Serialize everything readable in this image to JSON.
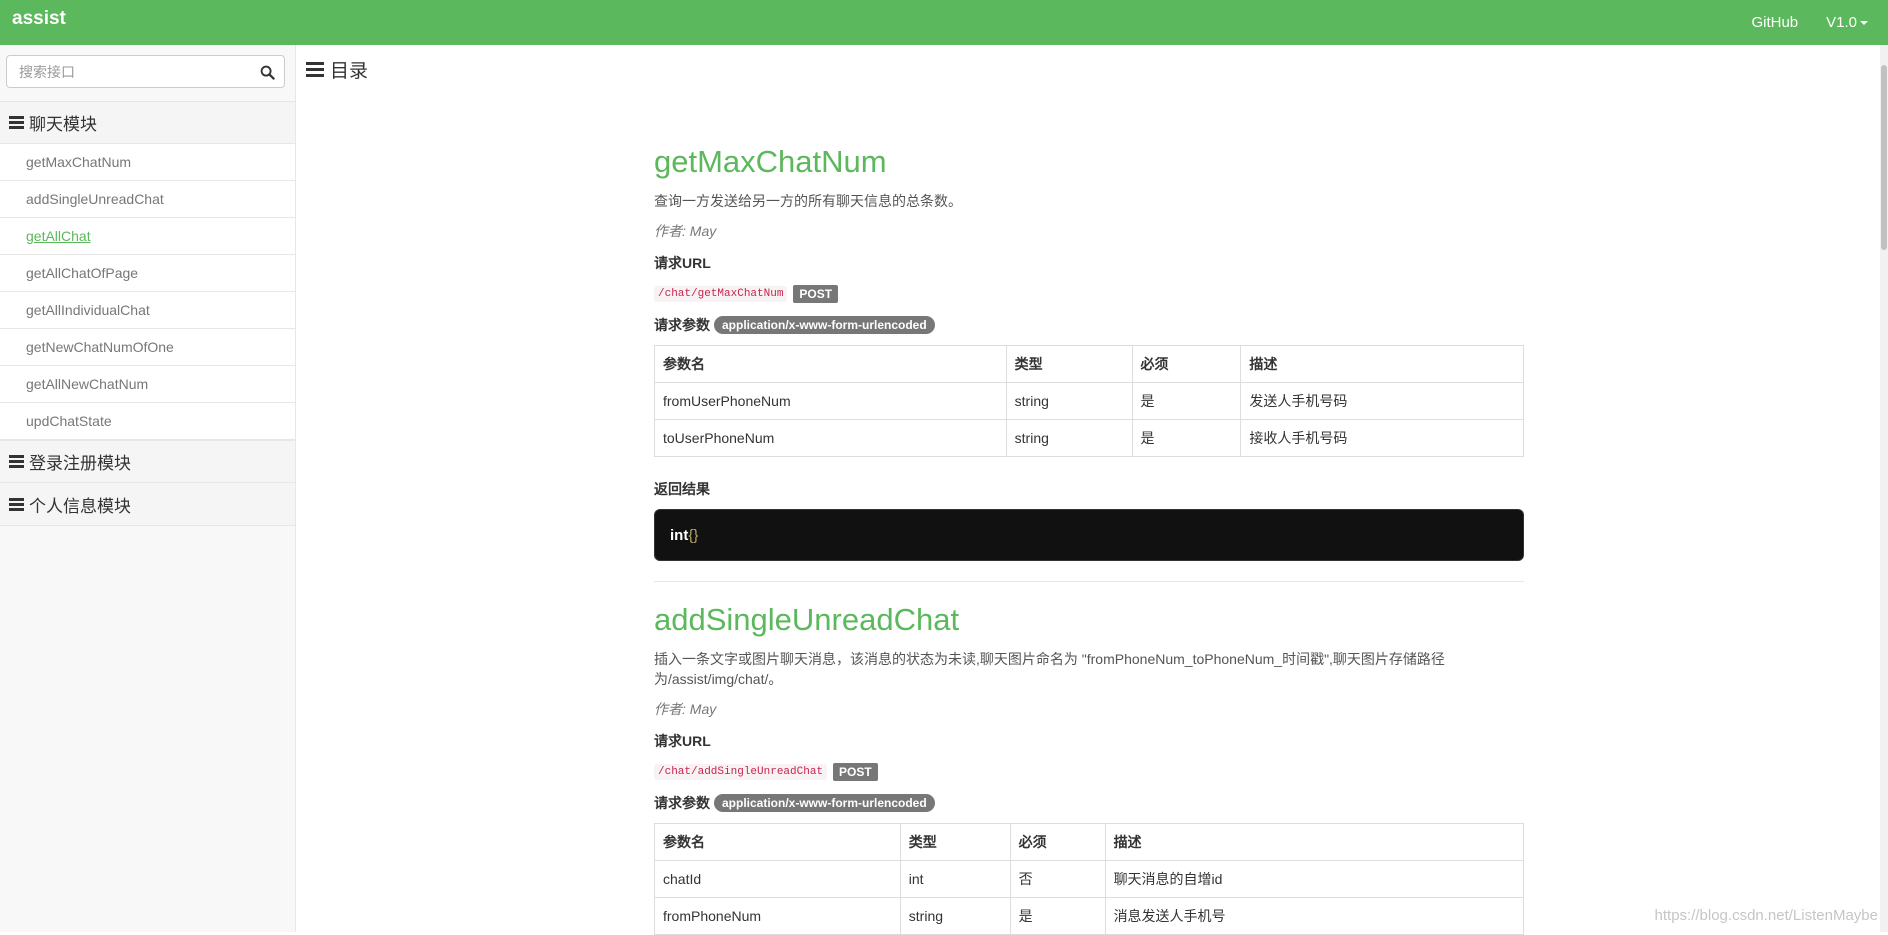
{
  "topbar": {
    "brand": "assist",
    "github": "GitHub",
    "version": "V1.0"
  },
  "search": {
    "placeholder": "搜索接口"
  },
  "sidebar": {
    "groups": [
      {
        "label": "聊天模块",
        "items": [
          "getMaxChatNum",
          "addSingleUnreadChat",
          "getAllChat",
          "getAllChatOfPage",
          "getAllIndividualChat",
          "getNewChatNumOfOne",
          "getAllNewChatNum",
          "updChatState"
        ]
      },
      {
        "label": "登录注册模块"
      },
      {
        "label": "个人信息模块"
      }
    ],
    "active_item": "getAllChat"
  },
  "toc": {
    "label": "目录"
  },
  "apis": [
    {
      "title": "getMaxChatNum",
      "desc": "查询一方发送给另一方的所有聊天信息的总条数。",
      "author": "作者: May",
      "url_label": "请求URL",
      "url": "/chat/getMaxChatNum",
      "method": "POST",
      "params_label": "请求参数",
      "content_type": "application/x-www-form-urlencoded",
      "headers": [
        "参数名",
        "类型",
        "必须",
        "描述"
      ],
      "rows": [
        [
          "fromUserPhoneNum",
          "string",
          "是",
          "发送人手机号码"
        ],
        [
          "toUserPhoneNum",
          "string",
          "是",
          "接收人手机号码"
        ]
      ],
      "result_label": "返回结果",
      "result_type": "int",
      "result_body": "{}"
    },
    {
      "title": "addSingleUnreadChat",
      "desc_line1": "插入一条文字或图片聊天消息，该消息的状态为未读,聊天图片命名为 \"fromPhoneNum_toPhoneNum_时间戳\",聊天图片存储路径",
      "desc_line2": "为/assist/img/chat/。",
      "author": "作者: May",
      "url_label": "请求URL",
      "url": "/chat/addSingleUnreadChat",
      "method": "POST",
      "params_label": "请求参数",
      "content_type": "application/x-www-form-urlencoded",
      "headers": [
        "参数名",
        "类型",
        "必须",
        "描述"
      ],
      "rows": [
        [
          "chatId",
          "int",
          "否",
          "聊天消息的自增id"
        ],
        [
          "fromPhoneNum",
          "string",
          "是",
          "消息发送人手机号"
        ]
      ]
    }
  ],
  "watermark": "https://blog.csdn.net/ListenMaybe",
  "colors": {
    "brand_green": "#5cb85c",
    "code_bg": "#111111",
    "badge_gray": "#777777"
  }
}
